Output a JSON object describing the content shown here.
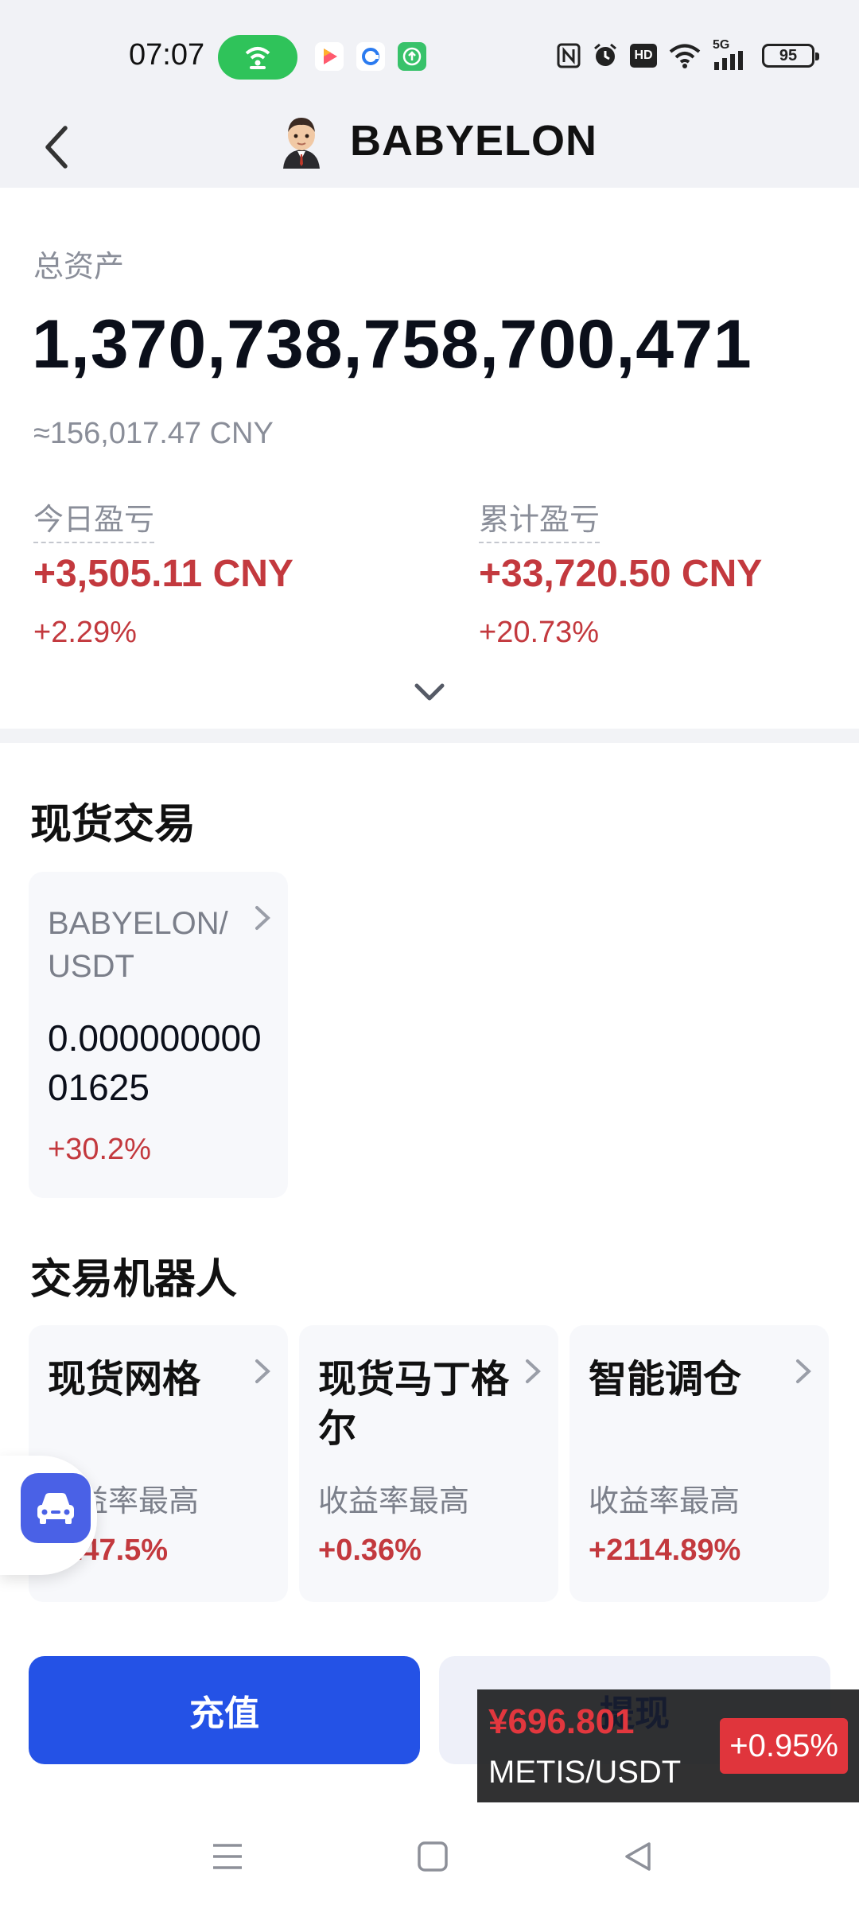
{
  "status_bar": {
    "time": "07:07",
    "battery": "95",
    "network_label": "5G",
    "hd_label": "HD",
    "icons": [
      "hotspot-icon",
      "video-app-icon",
      "browser-app-icon",
      "upload-app-icon",
      "nfc-icon",
      "alarm-icon",
      "hd-icon",
      "wifi-icon",
      "signal-icon",
      "battery-icon"
    ]
  },
  "header": {
    "title": "BABYELON",
    "back_icon": "back-arrow-icon",
    "avatar_icon": "coin-avatar-icon"
  },
  "assets": {
    "total_label": "总资产",
    "total_value": "1,370,738,758,700,471",
    "cny_approx": "≈156,017.47 CNY",
    "today_label": "今日盈亏",
    "today_value": "+3,505.11 CNY",
    "today_pct": "+2.29%",
    "cumulative_label": "累计盈亏",
    "cumulative_value": "+33,720.50 CNY",
    "cumulative_pct": "+20.73%"
  },
  "spot": {
    "section_title": "现货交易",
    "pair": "BABYELON/ USDT",
    "price": "0.00000000001625",
    "change": "+30.2%"
  },
  "bots": {
    "section_title": "交易机器人",
    "items": [
      {
        "title": "现货网格",
        "sub": "收益率最高",
        "pct": "+147.5%"
      },
      {
        "title": "现货马丁格尔",
        "sub": "收益率最高",
        "pct": "+0.36%"
      },
      {
        "title": "智能调仓",
        "sub": "收益率最高",
        "pct": "+2114.89%"
      }
    ]
  },
  "actions": {
    "deposit": "充值",
    "withdraw": "提现"
  },
  "ticker": {
    "price": "¥696.801",
    "pair": "METIS/USDT",
    "change": "+0.95%"
  },
  "colors": {
    "up_red": "#c3393e",
    "primary_blue": "#2452e6",
    "hotspot_green": "#2fc35a"
  }
}
